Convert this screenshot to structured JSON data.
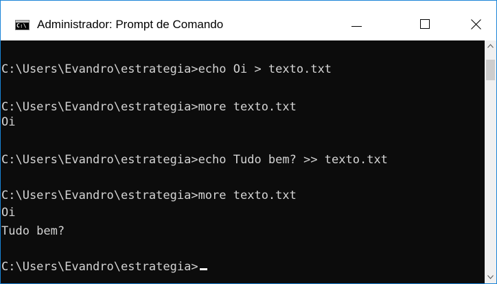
{
  "window": {
    "title": "Administrador: Prompt de Comando",
    "icon": "cmd-icon",
    "icon_text": "C:\\",
    "controls": {
      "minimize": "minimize-icon",
      "maximize": "maximize-icon",
      "close": "close-icon"
    }
  },
  "console": {
    "lines": [
      "C:\\Users\\Evandro\\estrategia>echo Oi > texto.txt",
      "C:\\Users\\Evandro\\estrategia>more texto.txt",
      "Oi",
      "C:\\Users\\Evandro\\estrategia>echo Tudo bem? >> texto.txt",
      "C:\\Users\\Evandro\\estrategia>more texto.txt",
      "Oi",
      "Tudo bem?",
      "C:\\Users\\Evandro\\estrategia>"
    ]
  },
  "colors": {
    "console_background": "#0c0c0c",
    "console_text": "#d4d4d4",
    "window_border": "#1883d7"
  }
}
